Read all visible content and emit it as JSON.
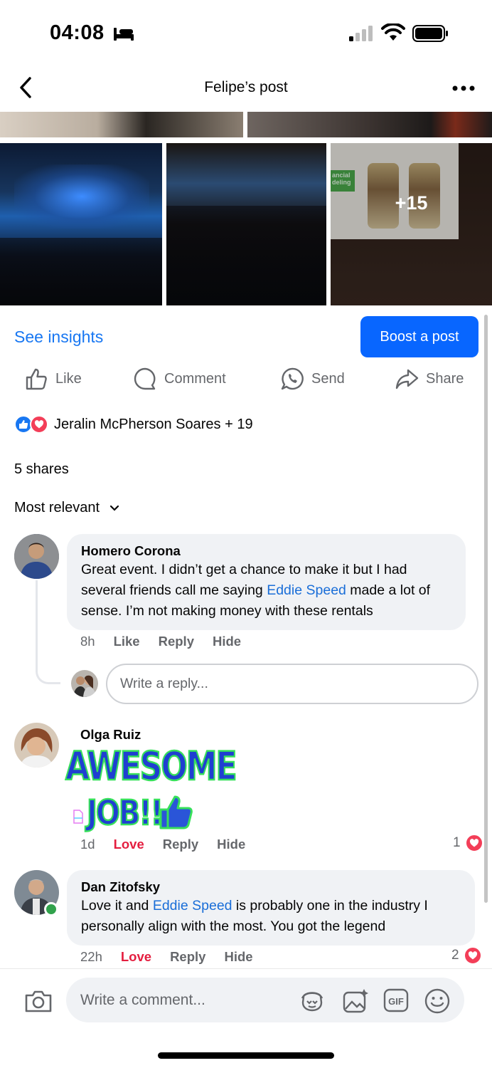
{
  "status_bar": {
    "time": "04:08",
    "icons": [
      "bed-icon",
      "signal-icon",
      "wifi-icon",
      "battery-icon"
    ]
  },
  "nav": {
    "title": "Felipe’s post",
    "back_icon": "chevron-left-icon",
    "more_icon": "more-horizontal-icon"
  },
  "photos": {
    "more_count": "+15",
    "screen_text": "ancial\ndeling"
  },
  "insights": {
    "see_insights": "See insights",
    "boost_label": "Boost a post"
  },
  "actions": {
    "like": "Like",
    "comment": "Comment",
    "send": "Send",
    "share": "Share"
  },
  "reactions": {
    "summary": "Jeralin McPherson Soares + 19"
  },
  "shares": "5 shares",
  "sort": {
    "label": "Most relevant"
  },
  "comments": [
    {
      "author": "Homero Corona",
      "text_before": "Great event. I didn’t get a chance to make it but I had several friends call me saying ",
      "mention": "Eddie Speed",
      "text_after": " made a lot of sense. I’m not making money with these rentals",
      "time": "8h",
      "like": "Like",
      "reply": "Reply",
      "hide": "Hide"
    },
    {
      "author": "Olga Ruiz",
      "sticker_line1": "AWESOME",
      "sticker_line2": "JOB!!",
      "time": "1d",
      "love": "Love",
      "reply": "Reply",
      "hide": "Hide",
      "reaction_count": "1"
    },
    {
      "author": "Dan Zitofsky",
      "text_before": "Love it and ",
      "mention": "Eddie Speed",
      "text_after": " is probably one in the industry I personally align with the most. You got the legend",
      "time": "22h",
      "love": "Love",
      "reply": "Reply",
      "hide": "Hide",
      "reaction_count": "2"
    }
  ],
  "reply_box": {
    "placeholder": "Write a reply..."
  },
  "composer": {
    "placeholder": "Write a comment...",
    "icons": [
      "camera-icon",
      "avatar-sticker-icon",
      "photo-sparkle-icon",
      "gif-icon",
      "emoji-icon"
    ]
  },
  "colors": {
    "brand_blue": "#0866ff",
    "link_blue": "#1877f2",
    "love_red": "#e41e3f",
    "bubble_gray": "#f0f2f5"
  }
}
